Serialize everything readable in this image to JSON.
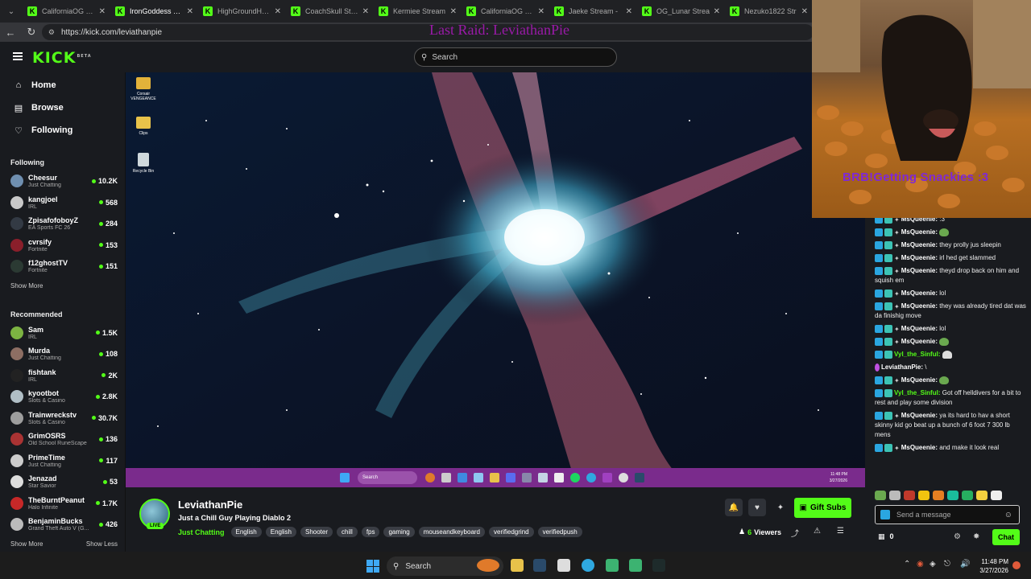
{
  "browser": {
    "tabs": [
      {
        "title": "CaliforniaOG Stre"
      },
      {
        "title": "IronGoddess Strea",
        "active": true
      },
      {
        "title": "HighGroundHere"
      },
      {
        "title": "CoachSkull Strea"
      },
      {
        "title": "Kermiee Stream"
      },
      {
        "title": "CaliforniaOG Stre"
      },
      {
        "title": "Jaeke Stream -"
      },
      {
        "title": "OG_Lunar Strea"
      },
      {
        "title": "Nezuko1822 Str"
      }
    ],
    "url": "https://kick.com/leviathanpie"
  },
  "overlay_text": {
    "last_raid": "Last Raid: LeviathanPie",
    "brb": "BRB!Getting Snackies :3"
  },
  "header": {
    "logo": "KICK",
    "logo_badge": "BETA",
    "search_placeholder": "Search"
  },
  "sidebar": {
    "nav": [
      {
        "label": "Home",
        "icon": "home-icon"
      },
      {
        "label": "Browse",
        "icon": "browse-icon"
      },
      {
        "label": "Following",
        "icon": "heart-icon"
      }
    ],
    "following_title": "Following",
    "following": [
      {
        "name": "Cheesur",
        "category": "Just Chatting",
        "viewers": "10.2K",
        "color": "#6f8fb0"
      },
      {
        "name": "kangjoel",
        "category": "IRL",
        "viewers": "568",
        "color": "#c9c9c9"
      },
      {
        "name": "ZpisafofoboyZ",
        "category": "EA Sports FC 26",
        "viewers": "284",
        "color": "#333a44"
      },
      {
        "name": "cvrsify",
        "category": "Fortnite",
        "viewers": "153",
        "color": "#8a1f2b"
      },
      {
        "name": "f12ghostTV",
        "category": "Fortnite",
        "viewers": "151",
        "color": "#2b3a33"
      }
    ],
    "show_more": "Show More",
    "recommended_title": "Recommended",
    "recommended": [
      {
        "name": "Sam",
        "category": "IRL",
        "viewers": "1.5K",
        "color": "#7cb342"
      },
      {
        "name": "Murda",
        "category": "Just Chatting",
        "viewers": "108",
        "color": "#8d6e63"
      },
      {
        "name": "fishtank",
        "category": "IRL",
        "viewers": "2K",
        "color": "#222"
      },
      {
        "name": "kyootbot",
        "category": "Slots & Casino",
        "viewers": "2.8K",
        "color": "#b0bec5"
      },
      {
        "name": "Trainwreckstv",
        "category": "Slots & Casino",
        "viewers": "30.7K",
        "color": "#9e9e9e"
      },
      {
        "name": "GrimOSRS",
        "category": "Old School RuneScape",
        "viewers": "136",
        "color": "#a33"
      },
      {
        "name": "PrimeTime",
        "category": "Just Chatting",
        "viewers": "117",
        "color": "#ccc"
      },
      {
        "name": "Jenazad",
        "category": "Star Savior",
        "viewers": "53",
        "color": "#ddd"
      },
      {
        "name": "TheBurntPeanut",
        "category": "Halo Infinite",
        "viewers": "1.7K",
        "color": "#c62828"
      },
      {
        "name": "BenjaminBucks",
        "category": "Grand Theft Auto V (G...",
        "viewers": "426",
        "color": "#bbb"
      }
    ],
    "show_less": "Show Less"
  },
  "video": {
    "desktop_icons": [
      {
        "label": "Corsair VENGEANCE"
      },
      {
        "label": "Clips"
      },
      {
        "label": "Recycle Bin"
      }
    ],
    "taskbar_search": "Search",
    "clock_time": "11:48 PM",
    "clock_date": "3/27/2026"
  },
  "stream": {
    "streamer": "LeviathanPie",
    "live_badge": "LIVE",
    "title": "Just a Chill Guy Playing Diablo 2",
    "category": "Just Chatting",
    "tags": [
      "English",
      "English",
      "Shooter",
      "chill",
      "fps",
      "gaming",
      "mouseandkeyboard",
      "verifiedgrind",
      "verifiedpush"
    ],
    "gift_subs": "Gift Subs",
    "viewers_count": "6",
    "viewers_label": "Viewers"
  },
  "chat": {
    "messages": [
      {
        "user": "MsQueenie",
        "text": ":3",
        "color": "white"
      },
      {
        "user": "MsQueenie",
        "text": "",
        "emote": true,
        "color": "white"
      },
      {
        "user": "MsQueenie",
        "text": "they prolly jus sleepin",
        "color": "white"
      },
      {
        "user": "MsQueenie",
        "text": "irl hed get slammed",
        "color": "white"
      },
      {
        "user": "MsQueenie",
        "text": "theyd drop back on him and squish em",
        "color": "white"
      },
      {
        "user": "MsQueenie",
        "text": "lol",
        "color": "white"
      },
      {
        "user": "MsQueenie",
        "text": "they was already tired dat was da finishig move",
        "color": "white"
      },
      {
        "user": "MsQueenie",
        "text": "lol",
        "color": "white"
      },
      {
        "user": "MsQueenie",
        "text": "",
        "emote": true,
        "color": "white"
      },
      {
        "user": "Vyl_the_Sinful",
        "text": "",
        "emote": "ghost",
        "color": "green"
      },
      {
        "user": "LeviathanPie",
        "text": "\\",
        "color": "white"
      },
      {
        "user": "MsQueenie",
        "text": "",
        "emote": true,
        "color": "white"
      },
      {
        "user": "Vyl_the_Sinful",
        "text": "Got off helldivers for a bit to rest and play some division",
        "color": "green"
      },
      {
        "user": "MsQueenie",
        "text": "ya its hard to hav a short skinny kid go beat up a bunch of 6 foot 7 300 lb mens",
        "color": "white"
      },
      {
        "user": "MsQueenie",
        "text": "and make it look real",
        "color": "white"
      }
    ],
    "input_placeholder": "Send a message",
    "points": "0",
    "chat_button": "Chat"
  },
  "os_taskbar": {
    "search": "Search",
    "time": "11:48 PM",
    "date": "3/27/2026"
  }
}
